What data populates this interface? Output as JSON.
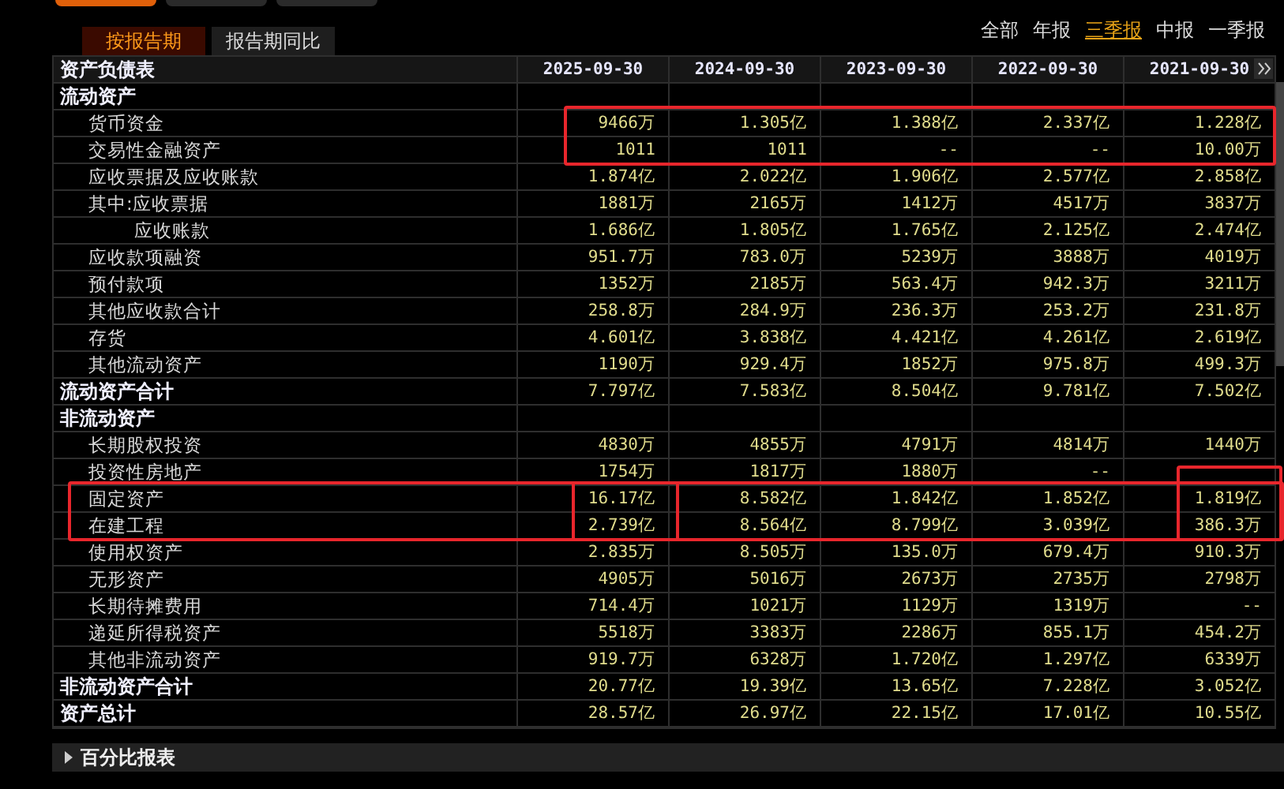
{
  "top_tabs": [
    {
      "selected": true
    },
    {
      "selected": false
    },
    {
      "selected": false
    }
  ],
  "report_tabs": [
    {
      "label": "按报告期",
      "selected": true
    },
    {
      "label": "报告期同比",
      "selected": false
    }
  ],
  "period_filters": [
    {
      "label": "全部",
      "selected": false
    },
    {
      "label": "年报",
      "selected": false
    },
    {
      "label": "三季报",
      "selected": true
    },
    {
      "label": "中报",
      "selected": false
    },
    {
      "label": "一季报",
      "selected": false
    }
  ],
  "table": {
    "title": "资产负债表",
    "columns": [
      "2025-09-30",
      "2024-09-30",
      "2023-09-30",
      "2022-09-30",
      "2021-09-30"
    ],
    "rows": [
      {
        "kind": "section",
        "label": "流动资产"
      },
      {
        "kind": "item",
        "label": "货币资金",
        "values": [
          "9466万",
          "1.305亿",
          "1.388亿",
          "2.337亿",
          "1.228亿"
        ]
      },
      {
        "kind": "item",
        "label": "交易性金融资产",
        "values": [
          "1011",
          "1011",
          "--",
          "--",
          "10.00万"
        ]
      },
      {
        "kind": "item",
        "label": "应收票据及应收账款",
        "values": [
          "1.874亿",
          "2.022亿",
          "1.906亿",
          "2.577亿",
          "2.858亿"
        ]
      },
      {
        "kind": "item",
        "label": "其中:应收票据",
        "values": [
          "1881万",
          "2165万",
          "1412万",
          "4517万",
          "3837万"
        ],
        "children": [
          {
            "kind": "item",
            "label": "应收账款",
            "values": [
              "1.686亿",
              "1.805亿",
              "1.765亿",
              "2.125亿",
              "2.474亿"
            ]
          }
        ]
      },
      {
        "kind": "item",
        "label": "应收款项融资",
        "values": [
          "951.7万",
          "783.0万",
          "5239万",
          "3888万",
          "4019万"
        ]
      },
      {
        "kind": "item",
        "label": "预付款项",
        "values": [
          "1352万",
          "2185万",
          "563.4万",
          "942.3万",
          "3211万"
        ]
      },
      {
        "kind": "item",
        "label": "其他应收款合计",
        "values": [
          "258.8万",
          "284.9万",
          "236.3万",
          "253.2万",
          "231.8万"
        ]
      },
      {
        "kind": "item",
        "label": "存货",
        "values": [
          "4.601亿",
          "3.838亿",
          "4.421亿",
          "4.261亿",
          "2.619亿"
        ]
      },
      {
        "kind": "item",
        "label": "其他流动资产",
        "values": [
          "1190万",
          "929.4万",
          "1852万",
          "975.8万",
          "499.3万"
        ]
      },
      {
        "kind": "total",
        "label": "流动资产合计",
        "values": [
          "7.797亿",
          "7.583亿",
          "8.504亿",
          "9.781亿",
          "7.502亿"
        ]
      },
      {
        "kind": "section",
        "label": "非流动资产"
      },
      {
        "kind": "item",
        "label": "长期股权投资",
        "values": [
          "4830万",
          "4855万",
          "4791万",
          "4814万",
          "1440万"
        ]
      },
      {
        "kind": "item",
        "label": "投资性房地产",
        "values": [
          "1754万",
          "1817万",
          "1880万",
          "--"
        ]
      },
      {
        "kind": "item",
        "label": "固定资产",
        "values": [
          "16.17亿",
          "8.582亿",
          "1.842亿",
          "1.852亿",
          "1.819亿"
        ]
      },
      {
        "kind": "item",
        "label": "在建工程",
        "values": [
          "2.739亿",
          "8.564亿",
          "8.799亿",
          "3.039亿",
          "386.3万"
        ]
      },
      {
        "kind": "item",
        "label": "使用权资产",
        "values": [
          "2.835万",
          "8.505万",
          "135.0万",
          "679.4万",
          "910.3万"
        ]
      },
      {
        "kind": "item",
        "label": "无形资产",
        "values": [
          "4905万",
          "5016万",
          "2673万",
          "2735万",
          "2798万"
        ]
      },
      {
        "kind": "item",
        "label": "长期待摊费用",
        "values": [
          "714.4万",
          "1021万",
          "1129万",
          "1319万",
          "--"
        ]
      },
      {
        "kind": "item",
        "label": "递延所得税资产",
        "values": [
          "5518万",
          "3383万",
          "2286万",
          "855.1万",
          "454.2万"
        ]
      },
      {
        "kind": "item",
        "label": "其他非流动资产",
        "values": [
          "919.7万",
          "6328万",
          "1.720亿",
          "1.297亿",
          "6339万"
        ]
      },
      {
        "kind": "total",
        "label": "非流动资产合计",
        "values": [
          "20.77亿",
          "19.39亿",
          "13.65亿",
          "7.228亿",
          "3.052亿"
        ]
      },
      {
        "kind": "total",
        "label": "资产总计",
        "values": [
          "28.57亿",
          "26.97亿",
          "22.15亿",
          "17.01亿",
          "10.55亿"
        ]
      }
    ]
  },
  "collapsed_section": {
    "label": "百分比报表",
    "expanded": false
  }
}
